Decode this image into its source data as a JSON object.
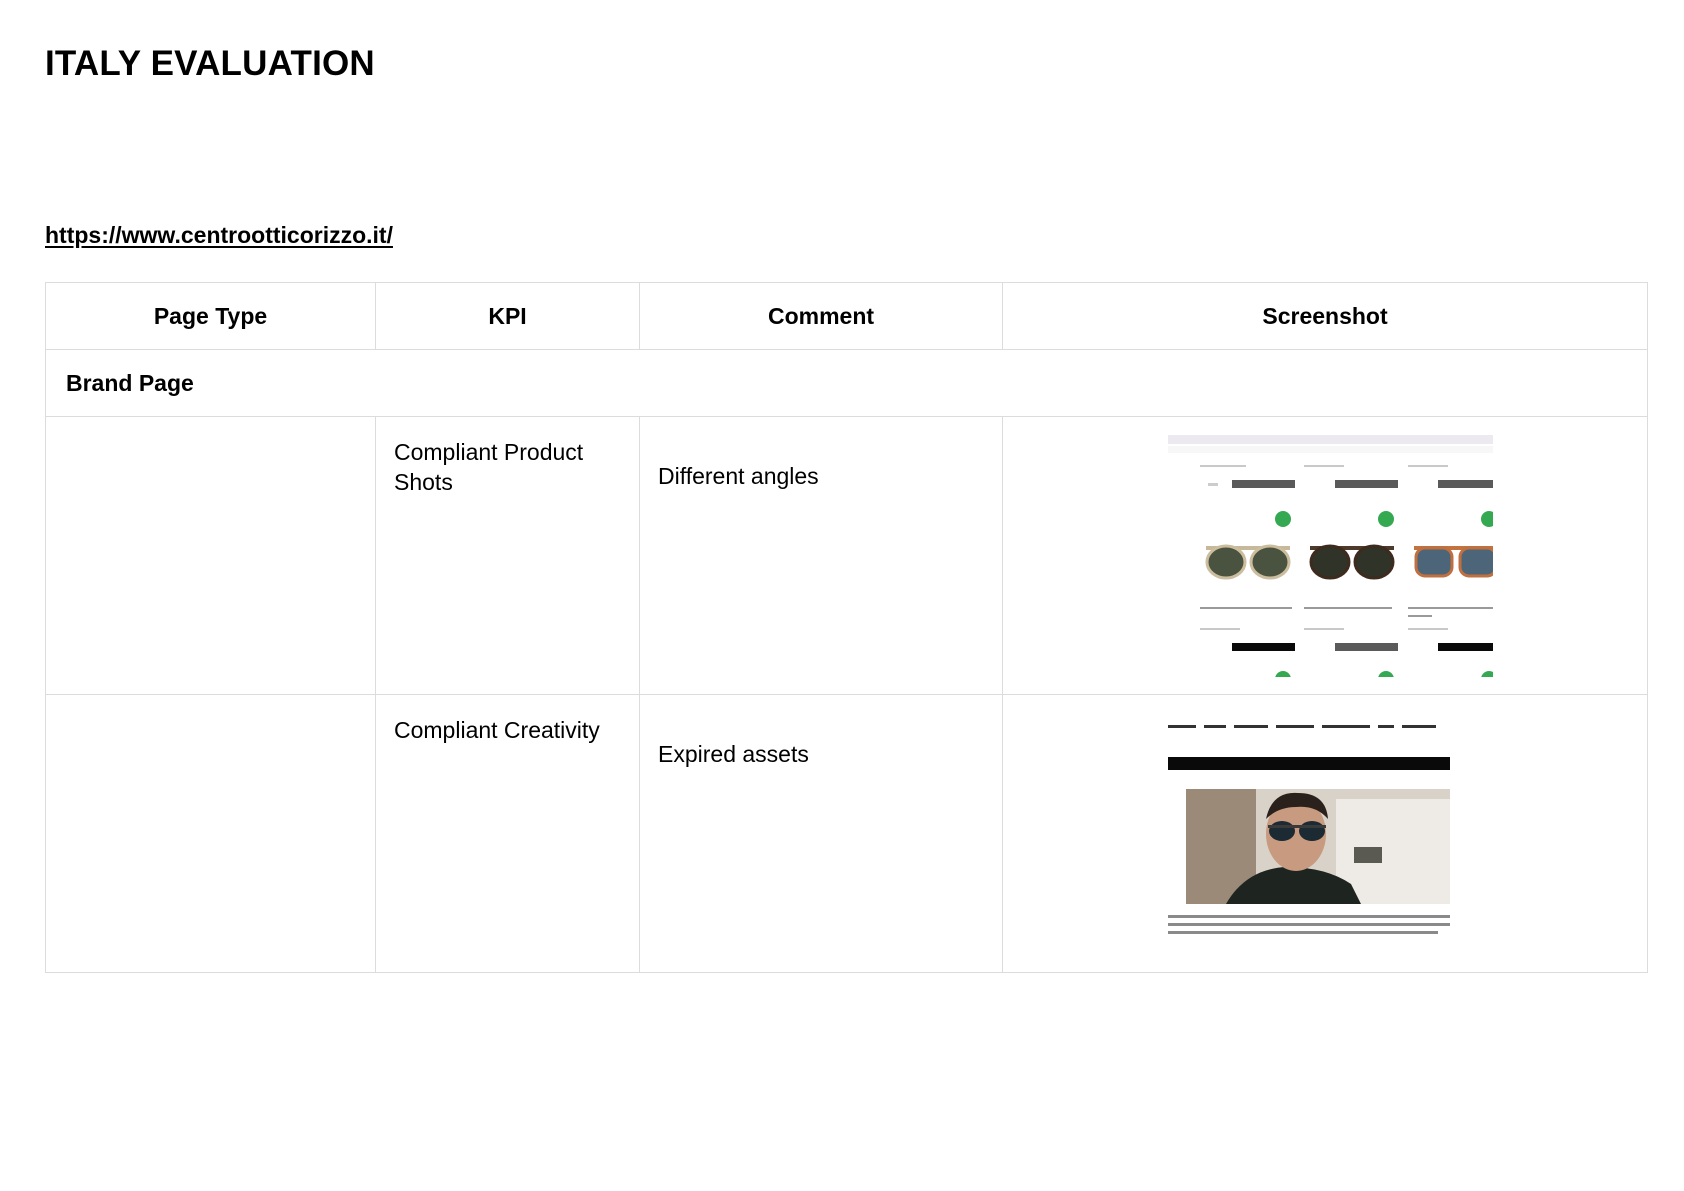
{
  "document": {
    "title": "ITALY EVALUATION",
    "url": "https://www.centrootticorizzo.it/"
  },
  "table": {
    "headers": {
      "page_type": "Page Type",
      "kpi": "KPI",
      "comment": "Comment",
      "screenshot": "Screenshot"
    },
    "section": "Brand Page",
    "rows": [
      {
        "page_type": "",
        "kpi": "Compliant Product Shots",
        "comment": "Different angles",
        "screenshot_icon": "sunglasses-product-grid-image"
      },
      {
        "page_type": "",
        "kpi": "Compliant Creativity",
        "comment": "Expired assets",
        "screenshot_icon": "brand-banner-image"
      }
    ]
  },
  "colors": {
    "border": "#dcdcdc",
    "badge_green": "#35a852",
    "dark_button": "#5a5a5a"
  }
}
